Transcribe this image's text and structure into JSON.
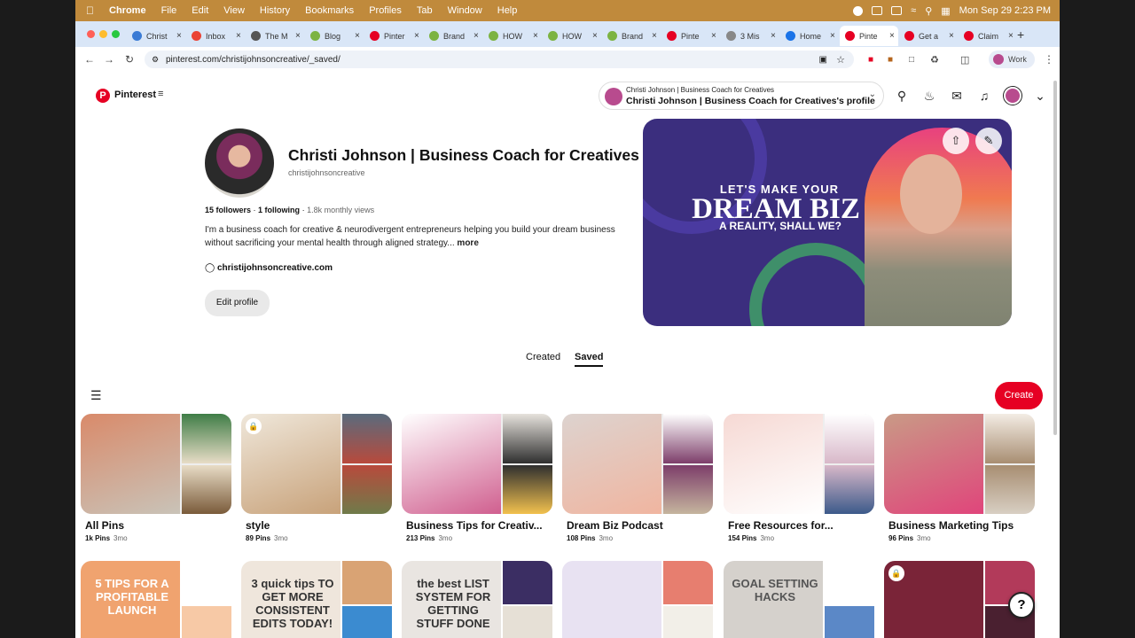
{
  "menubar": {
    "app": "Chrome",
    "items": [
      "File",
      "Edit",
      "View",
      "History",
      "Bookmarks",
      "Profiles",
      "Tab",
      "Window",
      "Help"
    ],
    "clock": "Mon Sep 29  2:23 PM"
  },
  "browser": {
    "tabs": [
      {
        "label": "Christ",
        "color": "#3a7bd5"
      },
      {
        "label": "Inbox",
        "color": "#ea4335"
      },
      {
        "label": "The M",
        "color": "#555555"
      },
      {
        "label": "Blog",
        "color": "#7cb342"
      },
      {
        "label": "Pinter",
        "color": "#e60023"
      },
      {
        "label": "Brand",
        "color": "#7cb342"
      },
      {
        "label": "HOW",
        "color": "#7cb342"
      },
      {
        "label": "HOW",
        "color": "#7cb342"
      },
      {
        "label": "Brand",
        "color": "#7cb342"
      },
      {
        "label": "Pinte",
        "color": "#e60023"
      },
      {
        "label": "3 Mis",
        "color": "#888888"
      },
      {
        "label": "Home",
        "color": "#1a73e8"
      },
      {
        "label": "Pinte",
        "color": "#e60023"
      },
      {
        "label": "Get a",
        "color": "#e60023"
      },
      {
        "label": "Claim",
        "color": "#e60023"
      }
    ],
    "active_tab_index": 12,
    "url": "pinterest.com/christijohnsoncreative/_saved/",
    "profile_button": "Work"
  },
  "header": {
    "brand": "Pinterest",
    "account_line1": "Christi Johnson | Business Coach for Creatives",
    "account_line2": "Christi Johnson | Business Coach for Creatives's profile"
  },
  "profile": {
    "name": "Christi Johnson | Business Coach for Creatives",
    "handle": "christijohnsoncreative",
    "followers": "15 followers",
    "following": "1 following",
    "monthly_views": "1.8k monthly views",
    "bio": "I'm a business coach for creative & neurodivergent entrepreneurs helping you build your dream business without sacrificing your mental health through aligned strategy...",
    "bio_more": "more",
    "website": "christijohnsoncreative.com",
    "edit_button": "Edit profile"
  },
  "banner": {
    "line1": "LET'S MAKE YOUR",
    "line2": "DREAM BIZ",
    "line3": "A REALITY, SHALL WE?"
  },
  "profile_tabs": {
    "created": "Created",
    "saved": "Saved"
  },
  "create_button": "Create",
  "boards": [
    {
      "title": "All Pins",
      "pins": "1k Pins",
      "age": "3mo",
      "colors": [
        "#d98a6a",
        "#c9c3b8",
        "#3f7d47",
        "#e8dcc6",
        "#7a5b3a"
      ]
    },
    {
      "title": "style",
      "pins": "89 Pins",
      "age": "3mo",
      "colors": [
        "#efe7da",
        "#c8a27a",
        "#5a6b7d",
        "#b84a3c",
        "#6f7b4a"
      ]
    },
    {
      "title": "Business Tips for Creativ...",
      "pins": "213 Pins",
      "age": "3mo",
      "colors": [
        "#ffffff",
        "#d05f8f",
        "#e6e2dc",
        "#2f2f2f",
        "#f2c14e"
      ]
    },
    {
      "title": "Dream Biz Podcast",
      "pins": "108 Pins",
      "age": "3mo",
      "colors": [
        "#ddd3cf",
        "#f0b5a0",
        "#ffffff",
        "#7d3e6a",
        "#c5b59e"
      ]
    },
    {
      "title": "Free Resources for...",
      "pins": "154 Pins",
      "age": "3mo",
      "colors": [
        "#f6d9d4",
        "#ffffff",
        "#ffffff",
        "#d8b8c9",
        "#3c5a8a"
      ]
    },
    {
      "title": "Business Marketing Tips",
      "pins": "96 Pins",
      "age": "3mo",
      "colors": [
        "#c99a86",
        "#e0457b",
        "#f3ece4",
        "#a88e72",
        "#d8cfc3"
      ]
    }
  ],
  "boards_row2": [
    {
      "text": "5 TIPS FOR A PROFITABLE LAUNCH",
      "colors": [
        "#f0a36f",
        "#ffffff",
        "#f7c9a6"
      ],
      "textcolor": "#ffffff"
    },
    {
      "text": "3 quick tips TO GET MORE CONSISTENT EDITS TODAY!",
      "colors": [
        "#efe6dc",
        "#d9a374",
        "#3b8bd0"
      ],
      "textcolor": "#333333"
    },
    {
      "text": "the best LIST SYSTEM FOR GETTING STUFF DONE",
      "colors": [
        "#e9e5e1",
        "#3b2e63",
        "#e6e0d6"
      ],
      "textcolor": "#333333"
    },
    {
      "text": "",
      "colors": [
        "#e8e2f2",
        "#e77e6f",
        "#f2efe8"
      ],
      "textcolor": "#333333"
    },
    {
      "text": "GOAL SETTING HACKS",
      "colors": [
        "#d5d1cc",
        "#ffffff",
        "#5b88c7"
      ],
      "textcolor": "#555555"
    },
    {
      "text": "",
      "colors": [
        "#7a2438",
        "#b23a5a",
        "#4a2030"
      ],
      "textcolor": "#ffffff"
    }
  ]
}
